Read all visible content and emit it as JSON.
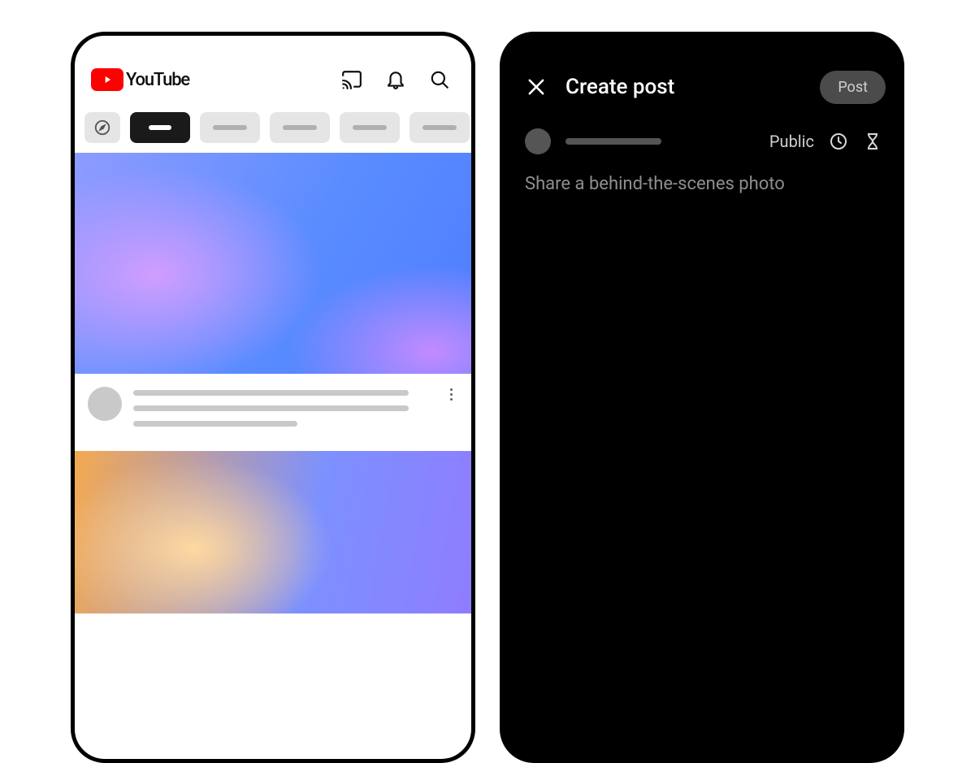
{
  "left": {
    "brand": "YouTube"
  },
  "right": {
    "title": "Create post",
    "post_button": "Post",
    "visibility": "Public",
    "placeholder": "Share a behind-the-scenes photo"
  }
}
